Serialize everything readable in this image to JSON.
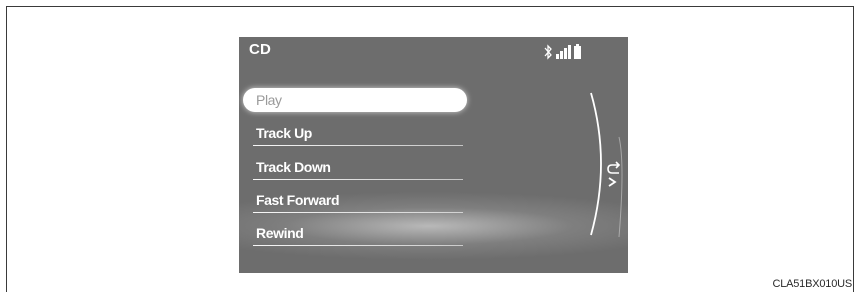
{
  "screen": {
    "title": "CD",
    "status_icons": [
      "bluetooth-icon",
      "signal-strength-icon",
      "battery-icon"
    ],
    "menu": [
      {
        "label": "Play",
        "selected": true
      },
      {
        "label": "Track Up",
        "selected": false
      },
      {
        "label": "Track Down",
        "selected": false
      },
      {
        "label": "Fast Forward",
        "selected": false
      },
      {
        "label": "Rewind",
        "selected": false
      }
    ],
    "back_icon": "back-arrow-icon",
    "colors": {
      "screen_bg": "#6d6d6d",
      "text": "#ffffff",
      "selected_bg": "#ffffff",
      "selected_text": "#9a9a9a"
    }
  },
  "figure_code": "CLA51BX010US"
}
